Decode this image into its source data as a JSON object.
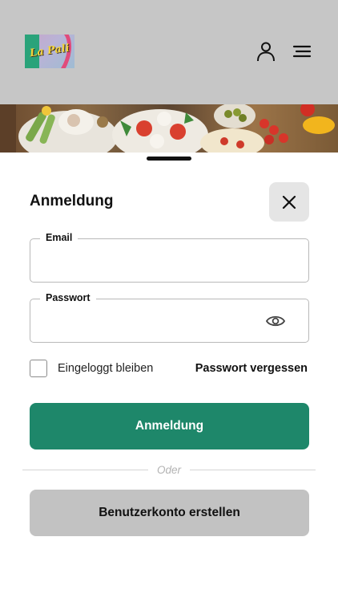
{
  "header": {
    "logo_text": "La Pali",
    "icons": {
      "user": "user-icon",
      "menu": "hamburger-menu-icon"
    }
  },
  "banner": {
    "image": "food-platter-image"
  },
  "login": {
    "title": "Anmeldung",
    "close_icon": "close-icon",
    "email": {
      "label": "Email",
      "value": "",
      "placeholder": ""
    },
    "password": {
      "label": "Passwort",
      "value": "",
      "placeholder": "",
      "toggle_icon": "eye-icon"
    },
    "remember_label": "Eingeloggt bleiben",
    "remember_checked": false,
    "forgot_label": "Passwort vergessen",
    "submit_label": "Anmeldung",
    "divider_text": "Oder",
    "register_label": "Benutzerkonto erstellen"
  },
  "colors": {
    "header_bg": "#c6c6c6",
    "primary": "#1e876a",
    "secondary_button": "#c2c2c2",
    "close_button_bg": "#e5e5e5",
    "field_border": "#b9b9b9"
  }
}
